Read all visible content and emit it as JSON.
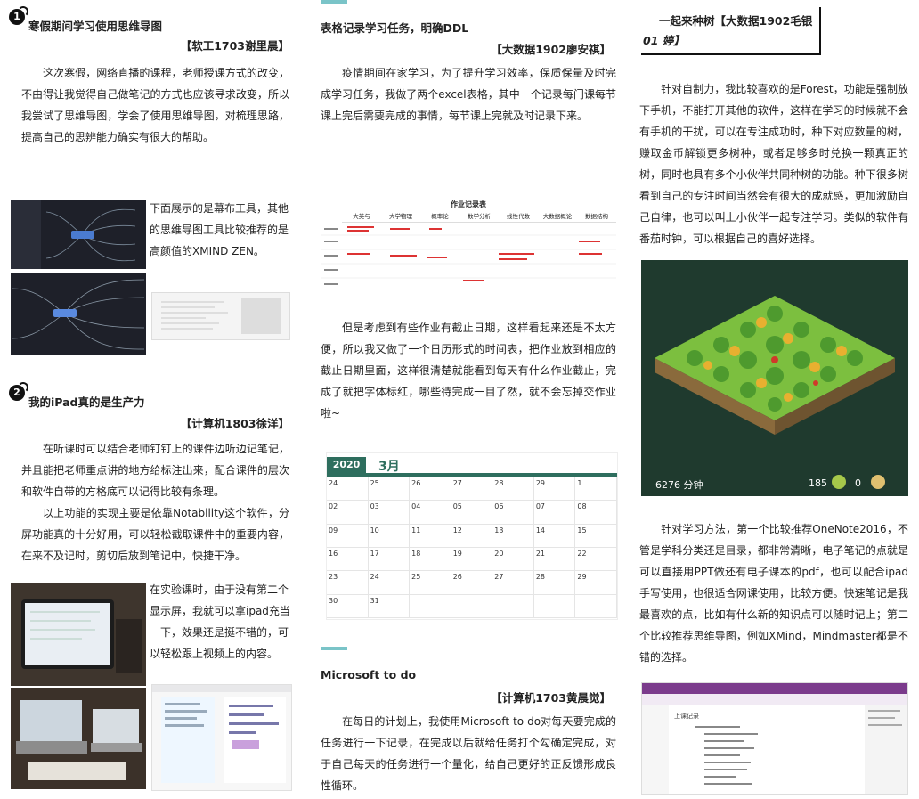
{
  "col1": {
    "sec1_num": "1",
    "sec1_title": "寒假期间学习使用思维导图",
    "sec1_author": "【软工1703谢里晨】",
    "sec1_para": "这次寒假，网络直播的课程，老师授课方式的改变，不由得让我觉得自己做笔记的方式也应该寻求改变，所以我尝试了思维导图，学会了使用思维导图，对梳理思路，提高自己的思辨能力确实有很大的帮助。",
    "sec1_side": "下面展示的是幕布工具，其他的思维导图工具比较推荐的是高颜值的XMIND ZEN。",
    "sec2_num": "2",
    "sec2_title": "我的iPad真的是生产力",
    "sec2_author": "【计算机1803徐洋】",
    "sec2_para1": "在听课时可以结合老师钉钉上的课件边听边记笔记，并且能把老师重点讲的地方给标注出来，配合课件的层次和软件自带的方格底可以记得比较有条理。",
    "sec2_para2": "以上功能的实现主要是依靠Notability这个软件，分屏功能真的十分好用，可以轻松截取课件中的重要内容，在来不及记时，剪切后放到笔记中，快捷干净。",
    "sec2_side": "在实验课时，由于没有第二个显示屏，我就可以拿ipad充当一下，效果还是挺不错的，可以轻松跟上视频上的内容。"
  },
  "col2": {
    "title1": "表格记录学习任务，明确DDL",
    "author1": "【大数据1902廖安祺】",
    "para1": "疫情期间在家学习，为了提升学习效率，保质保量及时完成学习任务，我做了两个excel表格，其中一个记录每门课每节课上完后需要完成的事情，每节课上完就及时记录下来。",
    "table_title": "作业记录表",
    "table_cols": [
      "大英与",
      "大学物理",
      "概率论",
      "数学分析",
      "线性代数",
      "大数据概论",
      "数据结构"
    ],
    "para2": "但是考虑到有些作业有截止日期，这样看起来还是不太方便，所以我又做了一个日历形式的时间表，把作业放到相应的截止日期里面，这样很清楚就能看到每天有什么作业截止，完成了就把字体标红，哪些待完成一目了然，就不会忘掉交作业啦~",
    "cal_year": "2020",
    "cal_month": "3月",
    "cal_days": [
      "24",
      "25",
      "26",
      "27",
      "28",
      "29",
      "1",
      "02",
      "03",
      "04",
      "05",
      "06",
      "07",
      "08",
      "09",
      "10",
      "11",
      "12",
      "13",
      "14",
      "15",
      "16",
      "17",
      "18",
      "19",
      "20",
      "21",
      "22",
      "23",
      "24",
      "25",
      "26",
      "27",
      "28",
      "29",
      "30",
      "31",
      "",
      "",
      "",
      "",
      ""
    ],
    "title2": "Microsoft to do",
    "author2": "【计算机1703黄晨觉】",
    "para3": "在每日的计划上，我使用Microsoft to do对每天要完成的任务进行一下记录，在完成以后就给任务打个勾确定完成，对于自己每天的任务进行一个量化，给自己更好的正反馈形成良性循环。"
  },
  "col3": {
    "title": "一起来种树【大数据1902毛银",
    "title2": "01 婷】",
    "para1": "针对自制力，我比较喜欢的是Forest，功能是强制放下手机，不能打开其他的软件，这样在学习的时候就不会有手机的干扰，可以在专注成功时，种下对应数量的树，赚取金币解锁更多树种，或者足够多时兑换一颗真正的树，同时也具有多个小伙伴共同种树的功能。种下很多树看到自己的专注时间当然会有很大的成就感，更加激励自己自律，也可以叫上小伙伴一起专注学习。类似的软件有番茄时钟，可以根据自己的喜好选择。",
    "forest_time": "6276 分钟",
    "forest_coins": "185",
    "forest_zero": "0",
    "para2": "针对学习方法，第一个比较推荐OneNote2016，不管是学科分类还是目录，都非常清晰，电子笔记的点就是可以直接用PPT做还有电子课本的pdf，也可以配合ipad手写使用，也很适合网课使用，比较方便。快速笔记是我最喜欢的点，比如有什么新的知识点可以随时记上；第二个比较推荐思维导图，例如XMind，Mindmaster都是不错的选择。",
    "onenote_page": "上课记录"
  },
  "colors": {
    "teal": "#7ac4c8",
    "calgreen": "#2e6e5e",
    "forestbg": "#1f3a2e",
    "accent": "#4a9a8a"
  }
}
